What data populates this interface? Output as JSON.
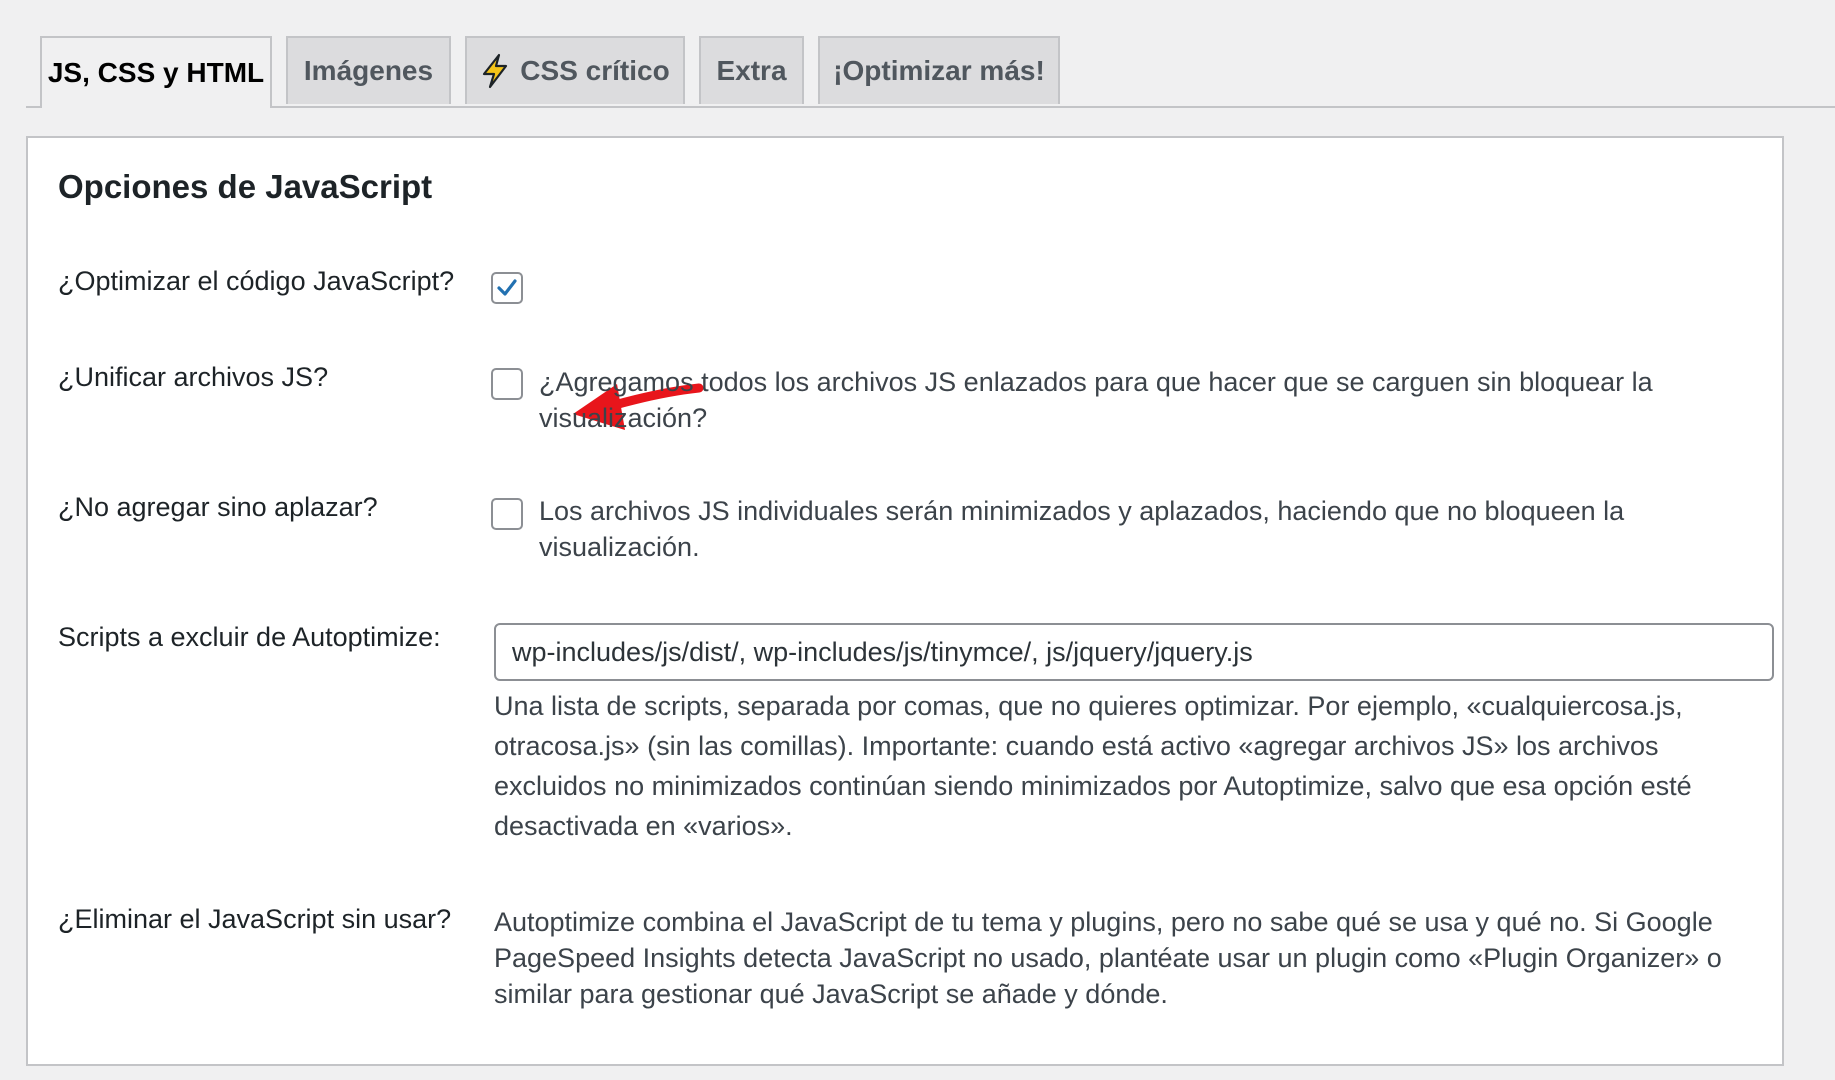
{
  "tabs": [
    {
      "label": "JS, CSS y HTML",
      "active": true
    },
    {
      "label": "Imágenes",
      "active": false
    },
    {
      "label": "CSS crítico",
      "active": false,
      "icon": "lightning-bolt-icon"
    },
    {
      "label": "Extra",
      "active": false
    },
    {
      "label": "¡Optimizar más!",
      "active": false
    }
  ],
  "section": {
    "title": "Opciones de JavaScript"
  },
  "options": {
    "optimize_js": {
      "label": "¿Optimizar el código JavaScript?",
      "checked": true
    },
    "aggregate_js": {
      "label": "¿Unificar archivos JS?",
      "checked": false,
      "description": "¿Agregamos todos los archivos JS enlazados para que hacer que se carguen sin bloquear la visualización?"
    },
    "defer_js": {
      "label": "¿No agregar sino aplazar?",
      "checked": false,
      "description": "Los archivos JS individuales serán minimizados y aplazados, haciendo que no bloqueen la visualización."
    },
    "exclude_scripts": {
      "label": "Scripts a excluir de Autoptimize:",
      "value": "wp-includes/js/dist/, wp-includes/js/tinymce/, js/jquery/jquery.js",
      "description": "Una lista de scripts, separada por comas, que no quieres optimizar. Por ejemplo, «cualquiercosa.js, otracosa.js» (sin las comillas). Importante: cuando está activo «agregar archivos JS» los archivos excluidos no minimizados continúan siendo minimizados por Autoptimize, salvo que esa opción esté desactivada en «varios»."
    },
    "unused_js": {
      "label": "¿Eliminar el JavaScript sin usar?",
      "description": "Autoptimize combina el JavaScript de tu tema y plugins, pero no sabe qué se usa y qué no. Si Google PageSpeed Insights detecta JavaScript no usado, plantéate usar un plugin como «Plugin Organizer» o similar para gestionar qué JavaScript se añade y dónde."
    }
  },
  "colors": {
    "checkmark": "#2271b1",
    "annotation_arrow": "#e8151b",
    "bolt_fill": "#f5c518"
  }
}
